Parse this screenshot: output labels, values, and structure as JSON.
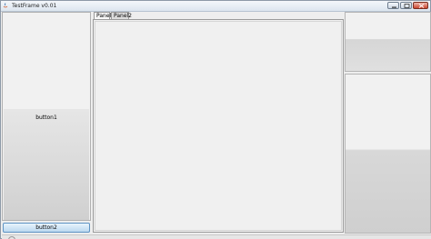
{
  "window": {
    "title": "TestFrame v0.01",
    "icon": "java-icon",
    "controls": [
      "minimize-icon",
      "maximize-icon",
      "close-icon"
    ]
  },
  "left_panel": {
    "button1_label": "button1",
    "button2_label": "button2"
  },
  "tabs": [
    {
      "label": "Panel1",
      "selected": true
    },
    {
      "label": "Panel2",
      "selected": false
    }
  ]
}
